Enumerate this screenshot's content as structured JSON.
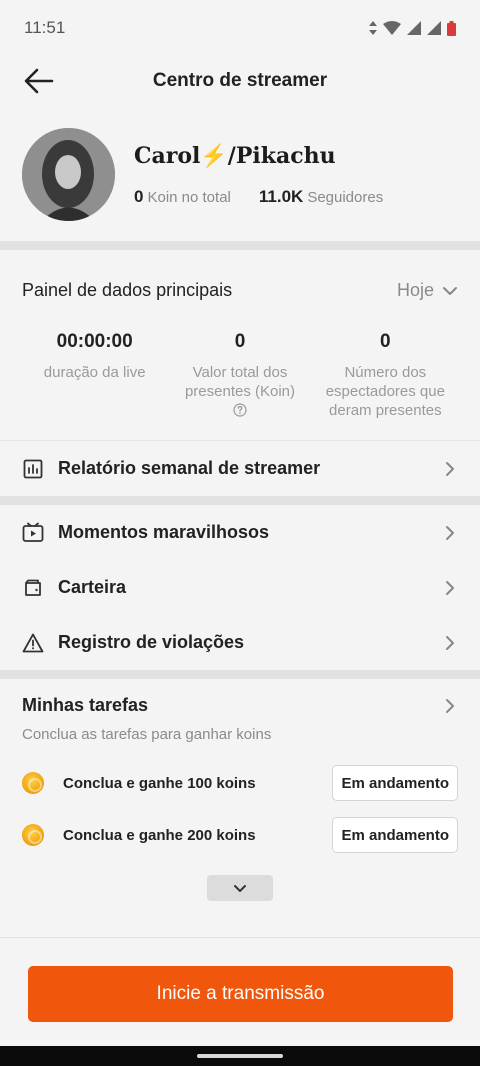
{
  "status_bar": {
    "time": "11:51"
  },
  "header": {
    "title": "Centro de streamer"
  },
  "profile": {
    "name": "Carol⚡/Pikachu",
    "koin_value": "0",
    "koin_label": "Koin no total",
    "followers_value": "11.0K",
    "followers_label": "Seguidores"
  },
  "panel": {
    "title": "Painel de dados principais",
    "period": "Hoje",
    "metrics": [
      {
        "value": "00:00:00",
        "label": "duração da live"
      },
      {
        "value": "0",
        "label": "Valor total dos presentes (Koin)"
      },
      {
        "value": "0",
        "label": "Número dos espectadores que deram presentes"
      }
    ]
  },
  "menu": {
    "weekly_report": "Relatório semanal de streamer",
    "moments": "Momentos maravilhosos",
    "wallet": "Carteira",
    "violations": "Registro de violações"
  },
  "tasks": {
    "title": "Minhas tarefas",
    "subtitle": "Conclua as tarefas para ganhar koins",
    "items": [
      {
        "label": "Conclua e ganhe 100 koins",
        "status": "Em andamento"
      },
      {
        "label": "Conclua e ganhe 200 koins",
        "status": "Em andamento"
      }
    ]
  },
  "cta": {
    "label": "Inicie a transmissão"
  },
  "colors": {
    "accent": "#f0560c",
    "background": "#f4f4f4",
    "muted_text": "#8a8a8a"
  },
  "icons": [
    "arrow-left-icon",
    "chart-icon",
    "play-icon",
    "wallet-icon",
    "warning-icon",
    "chevron-right-icon",
    "chevron-down-icon",
    "coin-icon",
    "help-icon"
  ]
}
